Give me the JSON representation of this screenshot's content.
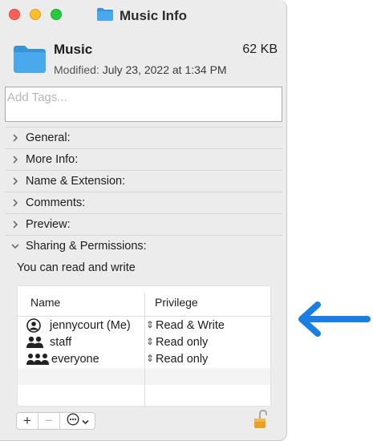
{
  "window": {
    "title": "Music Info"
  },
  "file": {
    "name": "Music",
    "size": "62 KB",
    "modified_label": "Modified:",
    "modified_value": "July 23, 2022 at 1:34 PM"
  },
  "tags": {
    "placeholder": "Add Tags..."
  },
  "sections": [
    {
      "label": "General:",
      "expanded": false
    },
    {
      "label": "More Info:",
      "expanded": false
    },
    {
      "label": "Name & Extension:",
      "expanded": false
    },
    {
      "label": "Comments:",
      "expanded": false
    },
    {
      "label": "Preview:",
      "expanded": false
    },
    {
      "label": "Sharing & Permissions:",
      "expanded": true
    }
  ],
  "permissions": {
    "description": "You can read and write",
    "columns": {
      "name": "Name",
      "privilege": "Privilege"
    },
    "rows": [
      {
        "name": "jennycourt (Me)",
        "privilege": "Read & Write",
        "icon": "user-icon"
      },
      {
        "name": "staff",
        "privilege": "Read only",
        "icon": "group-icon"
      },
      {
        "name": "everyone",
        "privilege": "Read only",
        "icon": "everyone-icon"
      }
    ]
  },
  "buttons": {
    "add": "+",
    "remove": "−"
  },
  "colors": {
    "folder": "#4aa8ec",
    "folder_tab": "#3a93d6",
    "annotation_arrow": "#1a7fe0",
    "close": "#fe5f57",
    "minimize": "#febc2e",
    "maximize": "#28c840"
  }
}
